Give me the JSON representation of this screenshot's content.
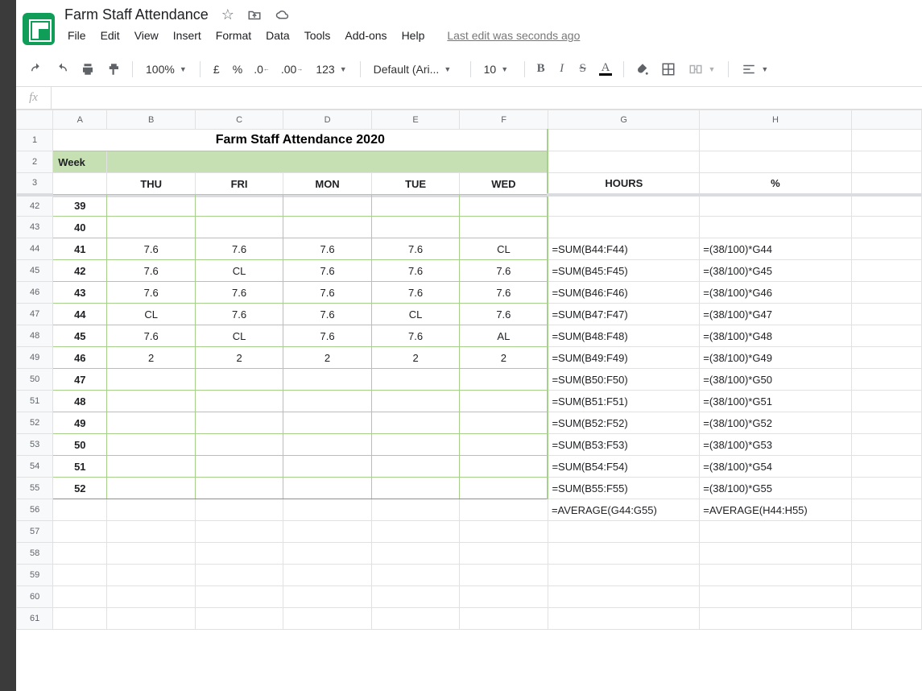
{
  "doc_title": "Farm Staff Attendance",
  "menus": [
    "File",
    "Edit",
    "View",
    "Insert",
    "Format",
    "Data",
    "Tools",
    "Add-ons",
    "Help"
  ],
  "last_edit": "Last edit was seconds ago",
  "toolbar": {
    "zoom": "100%",
    "currency": "£",
    "percent": "%",
    "dec_dec": ".0",
    "inc_dec": ".00",
    "more_fmt": "123",
    "font": "Default (Ari...",
    "font_size": "10"
  },
  "fx": "fx",
  "columns": [
    "A",
    "B",
    "C",
    "D",
    "E",
    "F",
    "G",
    "H"
  ],
  "merged_title": "Farm Staff Attendance 2020",
  "week_label": "Week",
  "day_headers": [
    "THU",
    "FRI",
    "MON",
    "TUE",
    "WED"
  ],
  "hours_header": "HOURS",
  "pct_header": "%",
  "rows": [
    {
      "rn": "42",
      "wk": "39",
      "d": [
        "",
        "",
        "",
        "",
        ""
      ],
      "g": "",
      "h": ""
    },
    {
      "rn": "43",
      "wk": "40",
      "d": [
        "",
        "",
        "",
        "",
        ""
      ],
      "g": "",
      "h": ""
    },
    {
      "rn": "44",
      "wk": "41",
      "d": [
        "7.6",
        "7.6",
        "7.6",
        "7.6",
        "CL"
      ],
      "g": "=SUM(B44:F44)",
      "h": "=(38/100)*G44"
    },
    {
      "rn": "45",
      "wk": "42",
      "d": [
        "7.6",
        "CL",
        "7.6",
        "7.6",
        "7.6"
      ],
      "g": "=SUM(B45:F45)",
      "h": "=(38/100)*G45"
    },
    {
      "rn": "46",
      "wk": "43",
      "d": [
        "7.6",
        "7.6",
        "7.6",
        "7.6",
        "7.6"
      ],
      "g": "=SUM(B46:F46)",
      "h": "=(38/100)*G46"
    },
    {
      "rn": "47",
      "wk": "44",
      "d": [
        "CL",
        "7.6",
        "7.6",
        "CL",
        "7.6"
      ],
      "g": "=SUM(B47:F47)",
      "h": "=(38/100)*G47"
    },
    {
      "rn": "48",
      "wk": "45",
      "d": [
        "7.6",
        "CL",
        "7.6",
        "7.6",
        "AL"
      ],
      "g": "=SUM(B48:F48)",
      "h": "=(38/100)*G48"
    },
    {
      "rn": "49",
      "wk": "46",
      "d": [
        "2",
        "2",
        "2",
        "2",
        "2"
      ],
      "g": "=SUM(B49:F49)",
      "h": "=(38/100)*G49"
    },
    {
      "rn": "50",
      "wk": "47",
      "d": [
        "",
        "",
        "",
        "",
        ""
      ],
      "g": "=SUM(B50:F50)",
      "h": "=(38/100)*G50"
    },
    {
      "rn": "51",
      "wk": "48",
      "d": [
        "",
        "",
        "",
        "",
        ""
      ],
      "g": "=SUM(B51:F51)",
      "h": "=(38/100)*G51"
    },
    {
      "rn": "52",
      "wk": "49",
      "d": [
        "",
        "",
        "",
        "",
        ""
      ],
      "g": "=SUM(B52:F52)",
      "h": "=(38/100)*G52"
    },
    {
      "rn": "53",
      "wk": "50",
      "d": [
        "",
        "",
        "",
        "",
        ""
      ],
      "g": "=SUM(B53:F53)",
      "h": "=(38/100)*G53"
    },
    {
      "rn": "54",
      "wk": "51",
      "d": [
        "",
        "",
        "",
        "",
        ""
      ],
      "g": "=SUM(B54:F54)",
      "h": "=(38/100)*G54"
    },
    {
      "rn": "55",
      "wk": "52",
      "d": [
        "",
        "",
        "",
        "",
        ""
      ],
      "g": "=SUM(B55:F55)",
      "h": "=(38/100)*G55"
    },
    {
      "rn": "56",
      "wk": "",
      "d": [
        "",
        "",
        "",
        "",
        ""
      ],
      "g": "=AVERAGE(G44:G55)",
      "h": "=AVERAGE(H44:H55)"
    },
    {
      "rn": "57",
      "wk": "",
      "d": [
        "",
        "",
        "",
        "",
        ""
      ],
      "g": "",
      "h": ""
    },
    {
      "rn": "58",
      "wk": "",
      "d": [
        "",
        "",
        "",
        "",
        ""
      ],
      "g": "",
      "h": ""
    },
    {
      "rn": "59",
      "wk": "",
      "d": [
        "",
        "",
        "",
        "",
        ""
      ],
      "g": "",
      "h": ""
    },
    {
      "rn": "60",
      "wk": "",
      "d": [
        "",
        "",
        "",
        "",
        ""
      ],
      "g": "",
      "h": ""
    },
    {
      "rn": "61",
      "wk": "",
      "d": [
        "",
        "",
        "",
        "",
        ""
      ],
      "g": "",
      "h": ""
    }
  ]
}
